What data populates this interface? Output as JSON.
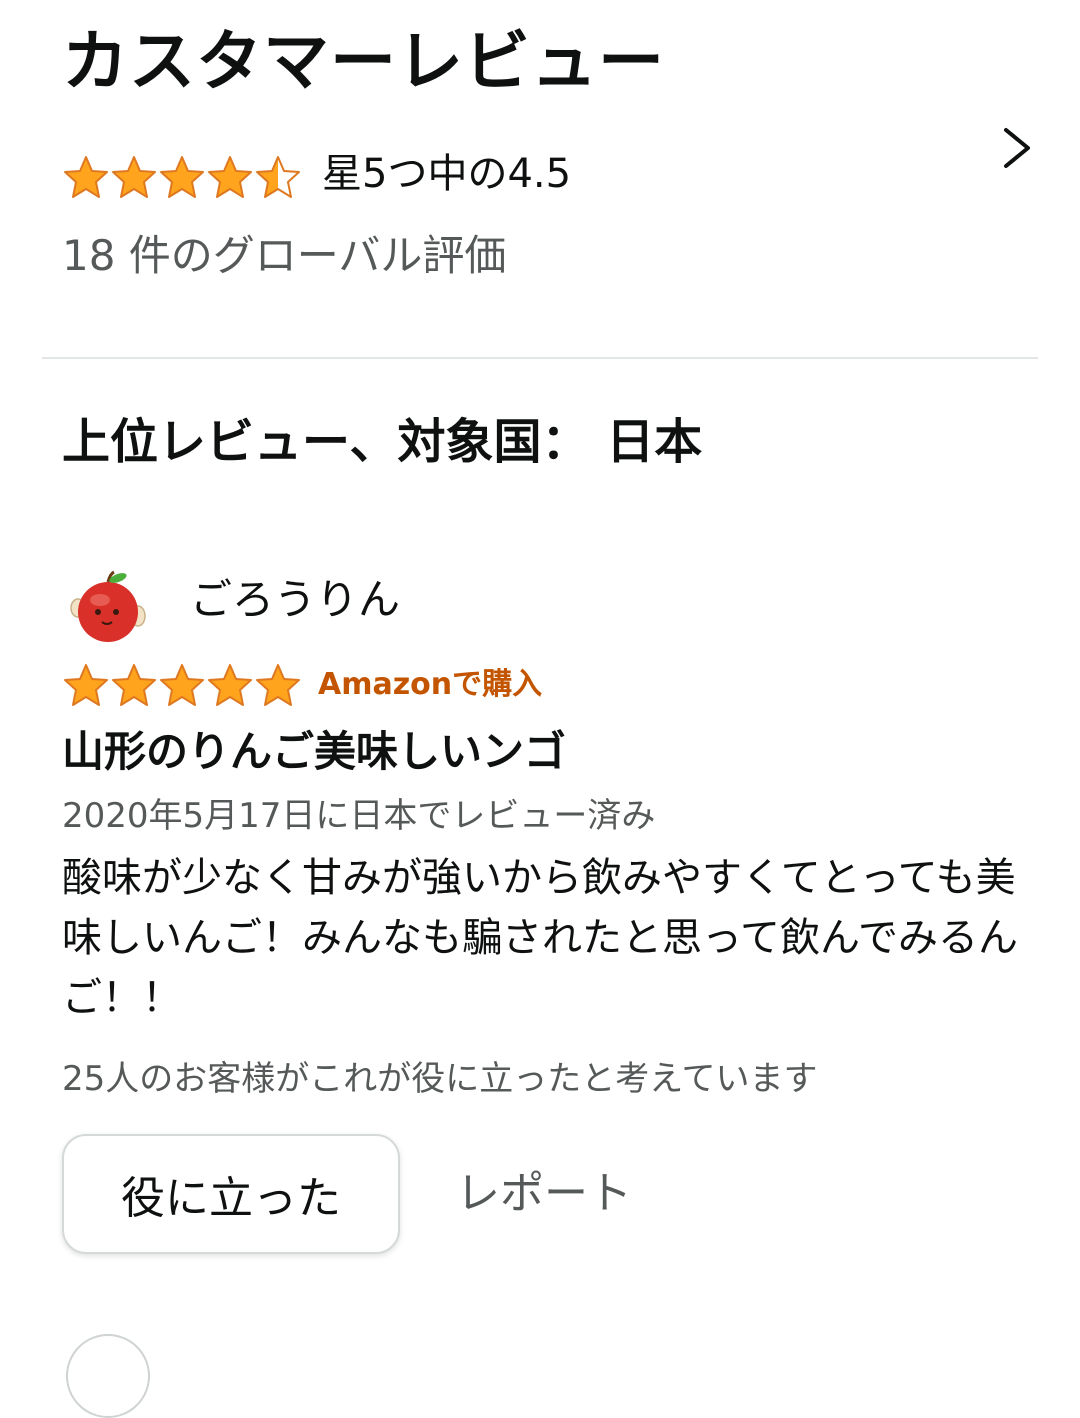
{
  "header": {
    "title": "カスタマーレビュー"
  },
  "summary": {
    "stars": 4.5,
    "rating_text": "星5つ中の4.5",
    "global_ratings": "18 件のグローバル評価"
  },
  "top_reviews": {
    "heading": "上位レビュー、対象国： 日本"
  },
  "review": {
    "reviewer_name": "ごろうりん",
    "stars": 5,
    "verified": "Amazonで購入",
    "title": "山形のりんご美味しいンゴ",
    "date": "2020年5月17日に日本でレビュー済み",
    "body": "酸味が少なく甘みが強いから飲みやすくてとっても美味しいんご！みんなも騙されたと思って飲んでみるんご！！",
    "helpful_text": "25人のお客様がこれが役に立ったと考えています",
    "helpful_button": "役に立った",
    "report_link": "レポート"
  },
  "colors": {
    "star": "#ffa41c",
    "star_stroke": "#de7921",
    "verified": "#c45500",
    "muted": "#565959"
  },
  "icons": {
    "star": "star-icon",
    "chevron": "chevron-right-icon",
    "avatar": "apple-avatar-icon"
  }
}
